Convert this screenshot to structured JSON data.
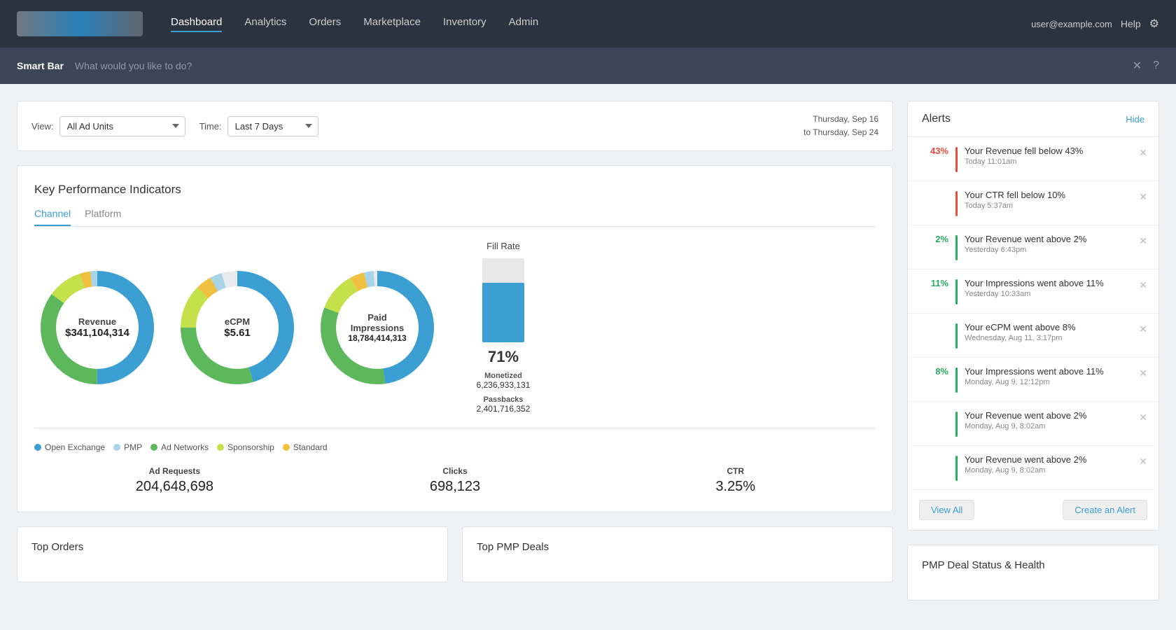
{
  "nav": {
    "links": [
      "Dashboard",
      "Analytics",
      "Orders",
      "Marketplace",
      "Inventory",
      "Admin"
    ],
    "active": "Dashboard",
    "help": "Help",
    "user": "user@example.com"
  },
  "smartbar": {
    "label": "Smart Bar",
    "placeholder": "What would you like to do?"
  },
  "filter": {
    "view_label": "View:",
    "view_value": "All Ad Units",
    "time_label": "Time:",
    "time_value": "Last 7 Days",
    "date_range": "Thursday, Sep 16\nto Thursday, Sep 24"
  },
  "kpi": {
    "title": "Key Performance Indicators",
    "tabs": [
      "Channel",
      "Platform"
    ],
    "active_tab": "Channel",
    "charts": [
      {
        "label": "Revenue",
        "value": "$341,104,314"
      },
      {
        "label": "eCPM",
        "value": "$5.61"
      },
      {
        "label": "Paid Impressions",
        "value": "18,784,414,313"
      }
    ],
    "fill_rate": {
      "title": "Fill Rate",
      "pct": 71,
      "pct_label": "71%",
      "monetized_label": "Monetized",
      "monetized_value": "6,236,933,131",
      "passbacks_label": "Passbacks",
      "passbacks_value": "2,401,716,352"
    },
    "legend": [
      {
        "label": "Open Exchange",
        "color": "#3b9fd4"
      },
      {
        "label": "PMP",
        "color": "#a8d4ea"
      },
      {
        "label": "Ad Networks",
        "color": "#5db85c"
      },
      {
        "label": "Sponsorship",
        "color": "#c5e04a"
      },
      {
        "label": "Standard",
        "color": "#f0c040"
      }
    ],
    "stats": [
      {
        "label": "Ad Requests",
        "value": "204,648,698"
      },
      {
        "label": "Clicks",
        "value": "698,123"
      },
      {
        "label": "CTR",
        "value": "3.25%"
      }
    ]
  },
  "alerts": {
    "title": "Alerts",
    "hide_label": "Hide",
    "items": [
      {
        "badge": "43%",
        "badge_type": "red",
        "bar_type": "red",
        "msg": "Your Revenue fell below 43%",
        "time": "Today 11:01am"
      },
      {
        "badge": "",
        "badge_type": "red",
        "bar_type": "red",
        "msg": "Your CTR fell below 10%",
        "time": "Today 5:37am"
      },
      {
        "badge": "2%",
        "badge_type": "green",
        "bar_type": "green",
        "msg": "Your Revenue went above 2%",
        "time": "Yesterday 6:43pm"
      },
      {
        "badge": "11%",
        "badge_type": "green",
        "bar_type": "green",
        "msg": "Your Impressions went above 11%",
        "time": "Yesterday 10:33am"
      },
      {
        "badge": "",
        "badge_type": "green",
        "bar_type": "green",
        "msg": "Your eCPM went above 8%",
        "time": "Wednesday, Aug 11, 3:17pm"
      },
      {
        "badge": "8%",
        "badge_type": "green",
        "bar_type": "green",
        "msg": "Your Impressions went above 11%",
        "time": "Monday, Aug 9, 12:12pm"
      },
      {
        "badge": "",
        "badge_type": "green",
        "bar_type": "green",
        "msg": "Your Revenue went above 2%",
        "time": "Monday, Aug 9, 8:02am"
      },
      {
        "badge": "",
        "badge_type": "green",
        "bar_type": "green",
        "msg": "Your Revenue went above 2%",
        "time": "Monday, Aug 9, 8:02am"
      }
    ],
    "view_all": "View All",
    "create_alert": "Create an Alert"
  },
  "bottom_cards": [
    {
      "title": "Top Orders"
    },
    {
      "title": "Top PMP Deals"
    },
    {
      "title": "PMP Deal Status & Health"
    }
  ]
}
